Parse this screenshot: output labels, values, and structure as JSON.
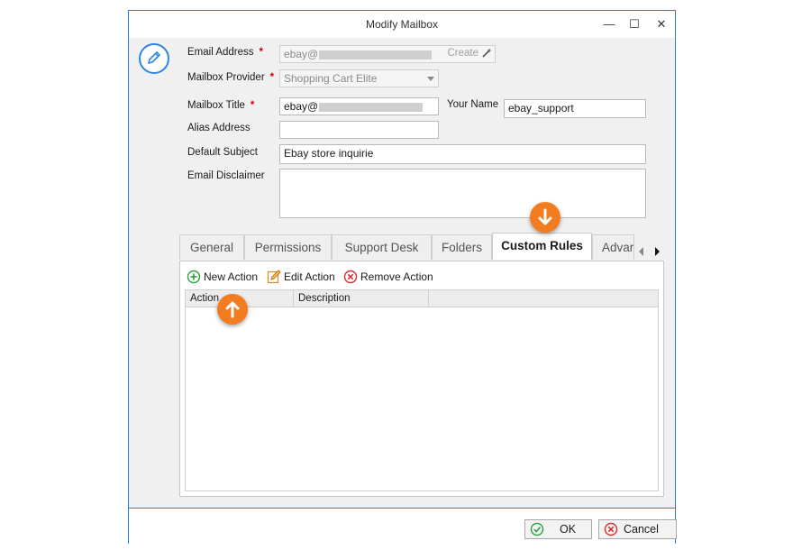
{
  "window": {
    "title": "Modify Mailbox",
    "controls": {
      "minimize": "—",
      "maximize": "☐",
      "close": "✕"
    }
  },
  "form": {
    "email_address": {
      "label": "Email Address",
      "value": "ebay@",
      "link": "Create",
      "required": "*"
    },
    "mailbox_provider": {
      "label": "Mailbox Provider",
      "value": "Shopping Cart Elite",
      "required": "*"
    },
    "mailbox_title": {
      "label": "Mailbox Title",
      "value": "ebay@",
      "required": "*"
    },
    "your_name": {
      "label": "Your Name",
      "value": "ebay_support"
    },
    "alias_address": {
      "label": "Alias Address",
      "value": ""
    },
    "default_subject": {
      "label": "Default Subject",
      "value": "Ebay store inquirie"
    },
    "email_disclaimer": {
      "label": "Email Disclaimer",
      "value": ""
    }
  },
  "tabs": [
    {
      "label": "General",
      "active": false
    },
    {
      "label": "Permissions",
      "active": false
    },
    {
      "label": "Support Desk",
      "active": false
    },
    {
      "label": "Folders",
      "active": false
    },
    {
      "label": "Custom Rules",
      "active": true
    },
    {
      "label": "Advar",
      "active": false
    }
  ],
  "toolbar": {
    "new_action": "New Action",
    "edit_action": "Edit Action",
    "remove_action": "Remove Action"
  },
  "grid": {
    "columns": [
      "Action",
      "Description",
      ""
    ],
    "rows": []
  },
  "footer": {
    "ok": "OK",
    "cancel": "Cancel"
  },
  "colors": {
    "accent": "#2b79d1",
    "callout": "#f47c20",
    "ok_green": "#2ea043",
    "cancel_red": "#d32f2f",
    "required_red": "#d00000"
  },
  "icons": {
    "edit": "pencil-icon",
    "new_action": "plus-circle-icon",
    "edit_action": "edit-pencil-icon",
    "remove_action": "x-circle-icon",
    "callout_down": "arrow-down-icon",
    "callout_up": "arrow-up-icon"
  }
}
